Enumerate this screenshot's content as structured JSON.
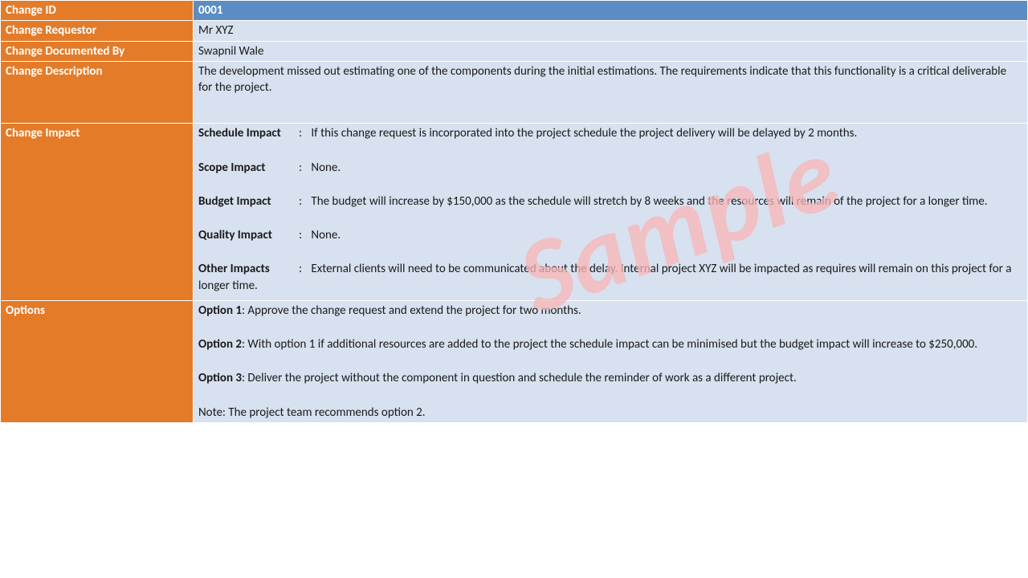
{
  "watermark": "Sample",
  "fields": {
    "change_id": {
      "label": "Change ID",
      "value": "0001"
    },
    "requestor": {
      "label": "Change Requestor",
      "value": "Mr XYZ"
    },
    "documented_by": {
      "label": "Change Documented By",
      "value": "Swapnil Wale"
    },
    "description": {
      "label": "Change Description",
      "value": "The development missed out estimating one of the components during the initial estimations. The requirements indicate that this functionality is a critical deliverable for the project."
    },
    "impact": {
      "label": "Change Impact",
      "items": [
        {
          "name": "Schedule Impact",
          "text": "If this change request is incorporated into the project schedule the project delivery will be delayed by 2 months."
        },
        {
          "name": "Scope Impact",
          "text": "None."
        },
        {
          "name": "Budget Impact",
          "text": "The budget will increase by $150,000 as the schedule will stretch by 8 weeks and the resources will remain of the project for a longer time."
        },
        {
          "name": "Quality Impact",
          "text": "None."
        },
        {
          "name": "Other Impacts",
          "text": "External clients will need to be communicated about the delay. Internal project XYZ will be impacted as requires will remain on this project for a longer time."
        }
      ]
    },
    "options": {
      "label": "Options",
      "items": [
        {
          "name": "Option 1",
          "text": ": Approve the change request and extend the project for two months."
        },
        {
          "name": "Option 2",
          "text": ": With option 1 if additional resources are added to the project the schedule impact can be minimised but the budget impact will increase to $250,000."
        },
        {
          "name": "Option 3",
          "text": ": Deliver the project without the component in question and schedule the reminder of work as a different project."
        }
      ],
      "note": "Note: The project team recommends option 2."
    }
  }
}
